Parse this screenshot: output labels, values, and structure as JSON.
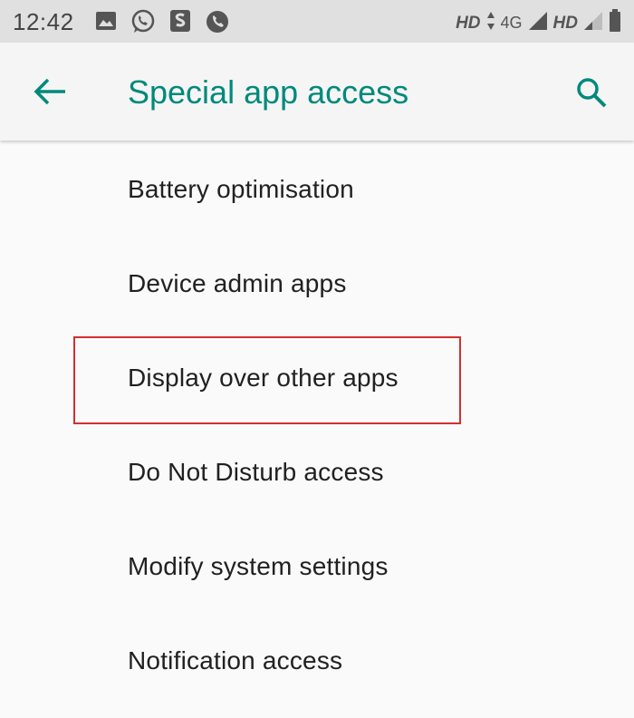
{
  "status_bar": {
    "time": "12:42",
    "hd_label_1": "HD",
    "network_label": "4G",
    "hd_label_2": "HD"
  },
  "app_bar": {
    "title": "Special app access"
  },
  "list": {
    "items": [
      {
        "label": "Battery optimisation"
      },
      {
        "label": "Device admin apps"
      },
      {
        "label": "Display over other apps"
      },
      {
        "label": "Do Not Disturb access"
      },
      {
        "label": "Modify system settings"
      },
      {
        "label": "Notification access"
      }
    ]
  },
  "colors": {
    "accent": "#00897b",
    "highlight": "#d32f2f",
    "status_bar_bg": "#e0e0e0"
  }
}
